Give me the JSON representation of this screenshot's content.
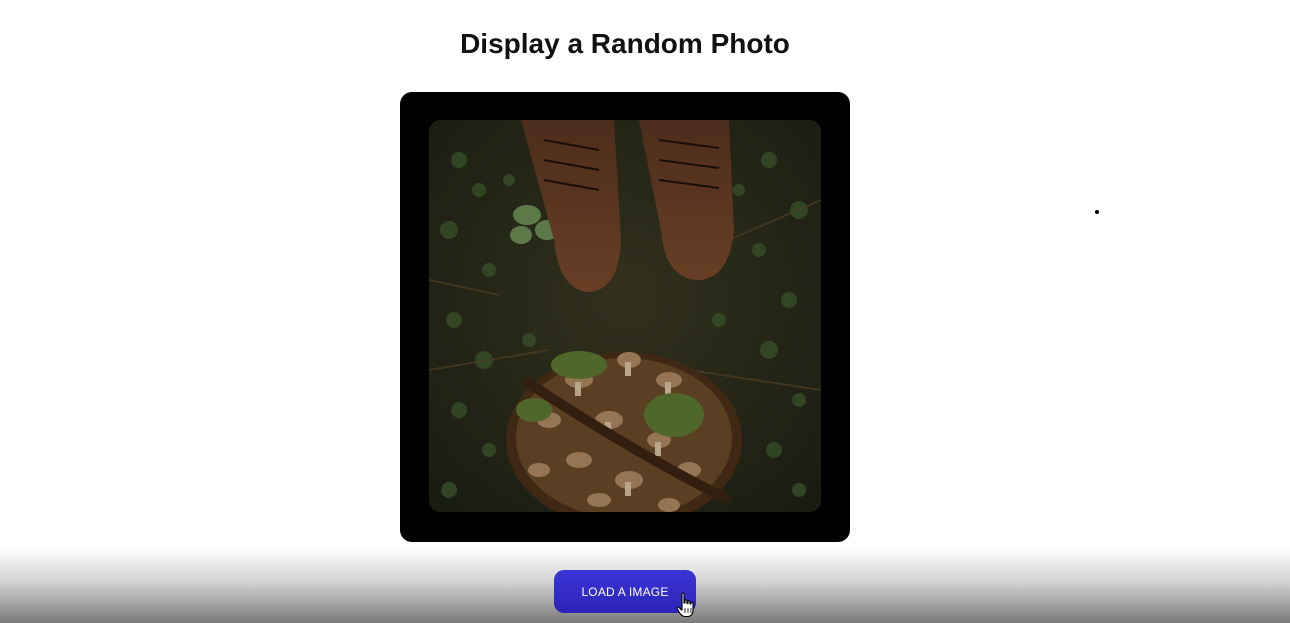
{
  "header": {
    "title": "Display a Random Photo"
  },
  "photo": {
    "subject": "boots-and-mushroom-basket-on-forest-floor"
  },
  "actions": {
    "load_label": "LOAD A IMAGE"
  },
  "colors": {
    "button": "#2f28c8",
    "frame": "#000000",
    "title": "#111111"
  },
  "icons": {
    "cursor": "hand-pointer-icon"
  }
}
